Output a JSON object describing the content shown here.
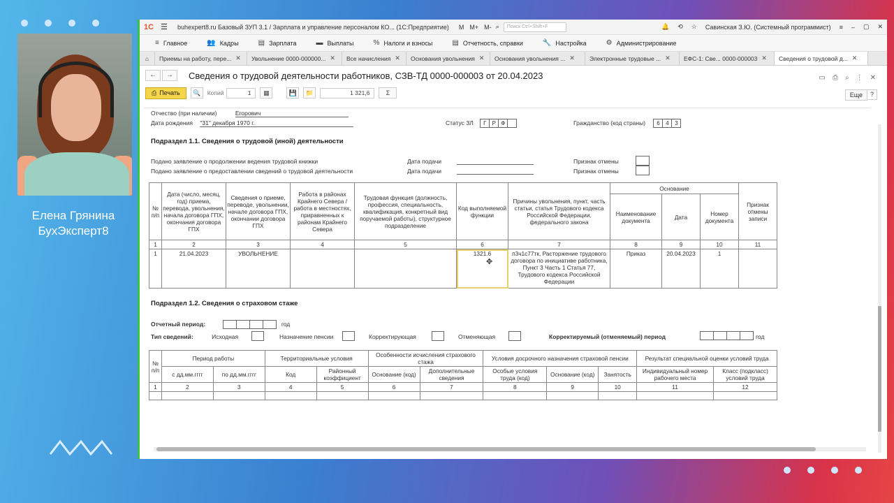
{
  "presenter": {
    "name": "Елена Грянина",
    "company": "БухЭксперт8"
  },
  "titlebar": {
    "logo": "1С",
    "title": "buhexpert8.ru Базовый ЗУП 3.1 / Зарплата и управление персоналом КО...  (1С:Предприятие)",
    "m1": "M",
    "m2": "M+",
    "m3": "M-",
    "search_placeholder": "Поиск Ctrl+Shift+F",
    "user": "Савинская З.Ю. (Системный программист)"
  },
  "menu": [
    {
      "icon": "≡",
      "label": "Главное"
    },
    {
      "icon": "👥",
      "label": "Кадры"
    },
    {
      "icon": "▤",
      "label": "Зарплата"
    },
    {
      "icon": "▬",
      "label": "Выплаты"
    },
    {
      "icon": "%",
      "label": "Налоги и взносы"
    },
    {
      "icon": "▤",
      "label": "Отчетность, справки"
    },
    {
      "icon": "🔧",
      "label": "Настройка"
    },
    {
      "icon": "⚙",
      "label": "Администрирование"
    }
  ],
  "tabs": [
    {
      "label": "Приемы на работу, пере..."
    },
    {
      "label": "Увольнение 0000-000000..."
    },
    {
      "label": "Все начисления"
    },
    {
      "label": "Основания увольнения"
    },
    {
      "label": "Основания увольнения ..."
    },
    {
      "label": "Электронные трудовые ..."
    },
    {
      "label": "ЕФС-1: Све... 0000-000003"
    },
    {
      "label": "Сведения о трудовой д..."
    }
  ],
  "doc": {
    "title": "Сведения о трудовой деятельности работников, СЗВ-ТД 0000-000003 от 20.04.2023",
    "print_label": "Печать",
    "copies_label": "Копий",
    "copies_value": "1",
    "sum_value": "1 321,6",
    "sum_icon": "Σ",
    "more_label": "Еще",
    "help_label": "?"
  },
  "form": {
    "patronymic_label": "Отчество (при наличии)",
    "patronymic_value": "Егорович",
    "birth_label": "Дата рождения",
    "birth_value": "\"31\" декабря 1970 г.",
    "status_label": "Статус ЗЛ",
    "status_cells": [
      "Г",
      "Р",
      "Ф",
      ""
    ],
    "citizenship_label": "Гражданство (код страны)",
    "citizenship_cells": [
      "6",
      "4",
      "3"
    ],
    "sub11_title": "Подраздел 1.1. Сведения о трудовой (иной) деятельности",
    "stmt1": "Подано заявление о продолжении ведения трудовой книжки",
    "stmt2": "Подано заявление о предоставлении сведений о трудовой деятельности",
    "date_label": "Дата подачи",
    "cancel_label": "Признак отмены",
    "sub12_title": "Подраздел 1.2. Сведения о страховом стаже",
    "period_label": "Отчетный период:",
    "year_label": "год",
    "type_label": "Тип сведений:",
    "type_src": "Исходная",
    "type_pension": "Назначение пенсии",
    "type_corr": "Корректирующая",
    "type_cancel": "Отменяющая",
    "corr_period": "Корректируемый (отменяемый) период"
  },
  "table1": {
    "headers": [
      "№ п/п",
      "Дата (число, месяц, год) приема, перевода, увольнения, начала договора ГПХ, окончания договора ГПХ",
      "Сведения о приеме, переводе, увольнении, начале договора ГПХ, окончании договора ГПХ",
      "Работа в районах Крайнего Севера / работа в местностях, приравненных к районам Крайнего Севера",
      "Трудовая функция (должность, профессия, специальность, квалификация, конкретный вид поручаемой работы), структурное подразделение",
      "Код выполняемой функции",
      "Причины увольнения, пункт, часть статьи, статья Трудового кодекса Российской Федерации, федерального закона",
      "Основание",
      "Признак отмены записи"
    ],
    "basis_sub": [
      "Наименование документа",
      "Дата",
      "Номер документа"
    ],
    "nums": [
      "1",
      "2",
      "3",
      "4",
      "5",
      "6",
      "7",
      "8",
      "9",
      "10",
      "11"
    ],
    "row": [
      "1",
      "21.04.2023",
      "УВОЛЬНЕНИЕ",
      "",
      "",
      "1321.6",
      "п3ч1с77тк, Расторжение трудового договора по инициативе работника, Пункт 3 Часть 1 Статья 77, Трудового кодекса Российской Федерации",
      "Приказ",
      "20.04.2023",
      "1",
      ""
    ]
  },
  "table2": {
    "headers": [
      "№ п/п",
      "Период работы",
      "Территориальные условия",
      "Особенности исчисления страхового стажа",
      "Условия досрочного назначения страховой пенсии",
      "Результат специальной оценки условий труда"
    ],
    "sub": [
      "с дд.мм.гггг",
      "по дд.мм.гггг",
      "Код",
      "Районный коэффициент",
      "Основание (код)",
      "Дополнительные сведения",
      "Особые условия труда (код)",
      "Основание (код)",
      "Занятость",
      "Индивидуальный номер рабочего места",
      "Класс (подкласс) условий труда"
    ],
    "nums": [
      "1",
      "2",
      "3",
      "4",
      "5",
      "6",
      "7",
      "8",
      "9",
      "10",
      "11",
      "12"
    ]
  }
}
